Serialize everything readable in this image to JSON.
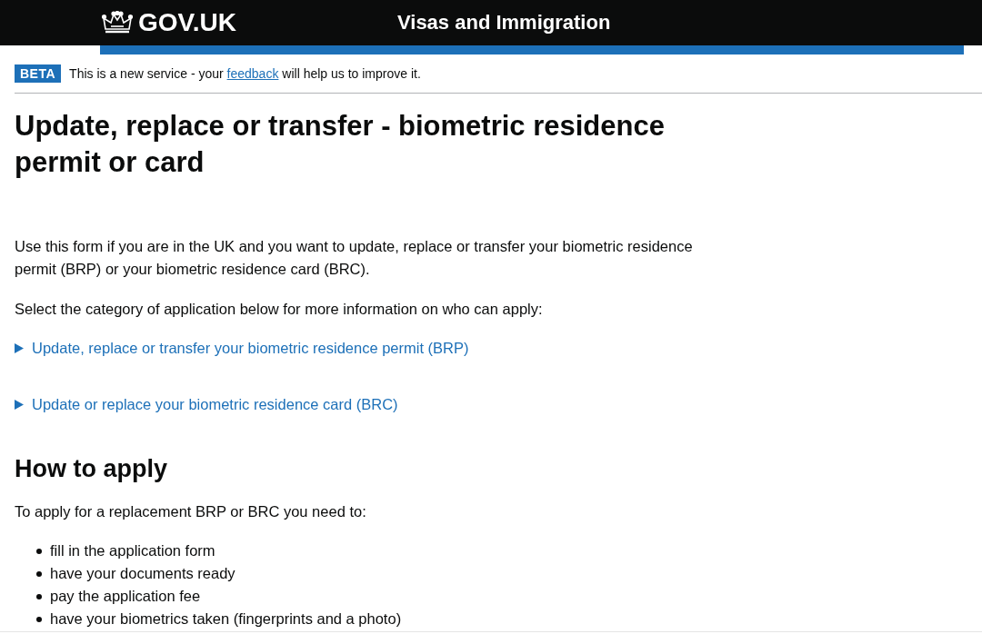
{
  "header": {
    "logo": "GOV.UK",
    "service_name": "Visas and Immigration"
  },
  "phase_banner": {
    "tag": "BETA",
    "text_before": "This is a new service - your",
    "link": "feedback",
    "text_after": "will help us to improve it."
  },
  "title": "Update, replace or transfer - biometric residence permit or card",
  "intro": "Use this form if you are in the UK and you want to update, replace or transfer your biometric residence permit (BRP) or your biometric residence card (BRC).",
  "select_prompt": "Select the category of application below for more information on who can apply:",
  "details": [
    {
      "summary": "Update, replace or transfer your biometric residence permit (BRP)",
      "expanded": false
    },
    {
      "summary": "Update or replace your biometric residence card (BRC)",
      "expanded": false
    }
  ],
  "how_to_apply": {
    "heading": "How to apply",
    "intro": "To apply for a replacement BRP or BRC you need to:",
    "steps": [
      "fill in the application form",
      "have your documents ready",
      "pay the application fee",
      "have your biometrics taken (fingerprints and a photo)"
    ]
  }
}
